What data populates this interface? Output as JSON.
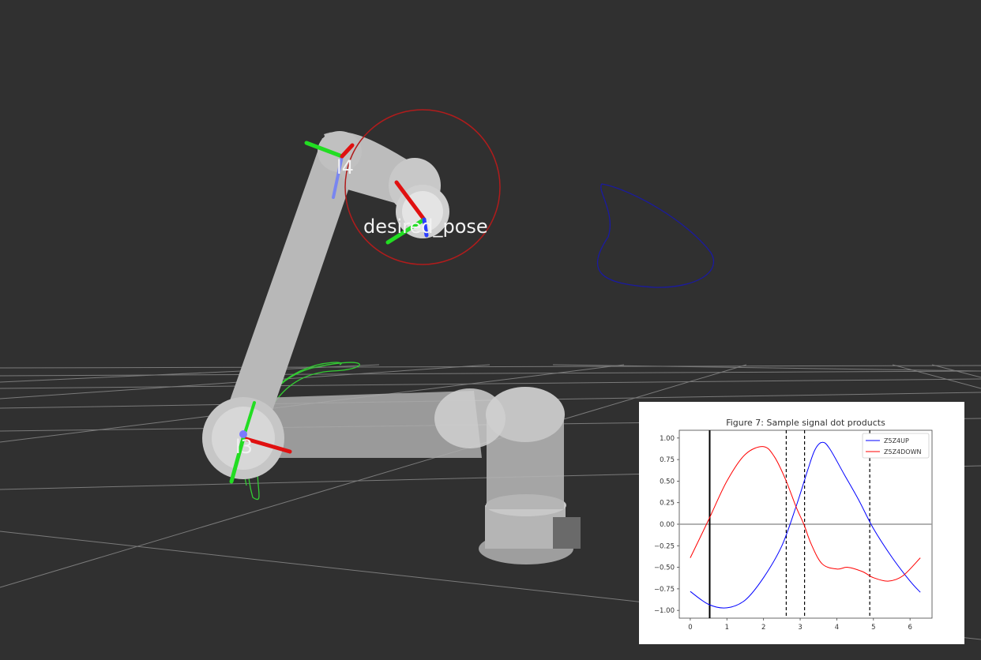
{
  "scene": {
    "frames": [
      {
        "label": "l4"
      },
      {
        "label": "desired_pose"
      },
      {
        "label": "l3"
      }
    ]
  },
  "colors": {
    "background": "#303030",
    "grid": "#a0a0a0",
    "link": "#bdbdbd",
    "x_axis": "#e01010",
    "y_axis": "#22dd22",
    "z_axis": "#2a3cff",
    "target_circle": "#c02020",
    "trace_blue": "#1a1aa0",
    "trace_green": "#33cc33"
  },
  "chart_data": {
    "type": "line",
    "title": "Figure 7: Sample signal dot products",
    "xlabel": "",
    "ylabel": "",
    "xlim": [
      -0.3,
      6.6
    ],
    "ylim": [
      -1.09,
      1.09
    ],
    "xticks": [
      0,
      1,
      2,
      3,
      4,
      5,
      6
    ],
    "yticks": [
      1.0,
      0.75,
      0.5,
      0.25,
      0.0,
      -0.25,
      -0.5,
      -0.75,
      -1.0
    ],
    "xtick_labels": [
      "0",
      "1",
      "2",
      "3",
      "4",
      "5",
      "6"
    ],
    "ytick_labels": [
      "1.00",
      "0.75",
      "0.50",
      "0.25",
      "0.00",
      "−0.25",
      "−0.50",
      "−0.75",
      "−1.00"
    ],
    "legend_position": "top-right",
    "hline": 0.0,
    "vlines": [
      {
        "x": 0.53,
        "style": "solid"
      },
      {
        "x": 2.62,
        "style": "dashed"
      },
      {
        "x": 3.12,
        "style": "dashed"
      },
      {
        "x": 4.9,
        "style": "dashed"
      }
    ],
    "series": [
      {
        "name": "Z5Z4UP",
        "color": "#0000ff",
        "x": [
          0,
          0.5,
          1.0,
          1.5,
          2.0,
          2.5,
          2.9,
          3.2,
          3.4,
          3.6,
          3.8,
          4.2,
          4.6,
          5.0,
          5.5,
          6.0,
          6.28
        ],
        "y": [
          -0.78,
          -0.93,
          -0.97,
          -0.88,
          -0.62,
          -0.25,
          0.22,
          0.62,
          0.86,
          0.95,
          0.88,
          0.58,
          0.28,
          -0.05,
          -0.38,
          -0.66,
          -0.79
        ]
      },
      {
        "name": "Z5Z4DOWN",
        "color": "#ff0000",
        "x": [
          0,
          0.5,
          1.0,
          1.5,
          2.0,
          2.3,
          2.6,
          2.9,
          3.1,
          3.3,
          3.6,
          4.0,
          4.3,
          4.7,
          5.0,
          5.4,
          5.8,
          6.28
        ],
        "y": [
          -0.39,
          0.05,
          0.5,
          0.81,
          0.9,
          0.78,
          0.52,
          0.19,
          0.0,
          -0.23,
          -0.46,
          -0.52,
          -0.5,
          -0.55,
          -0.62,
          -0.66,
          -0.6,
          -0.39
        ]
      }
    ]
  }
}
